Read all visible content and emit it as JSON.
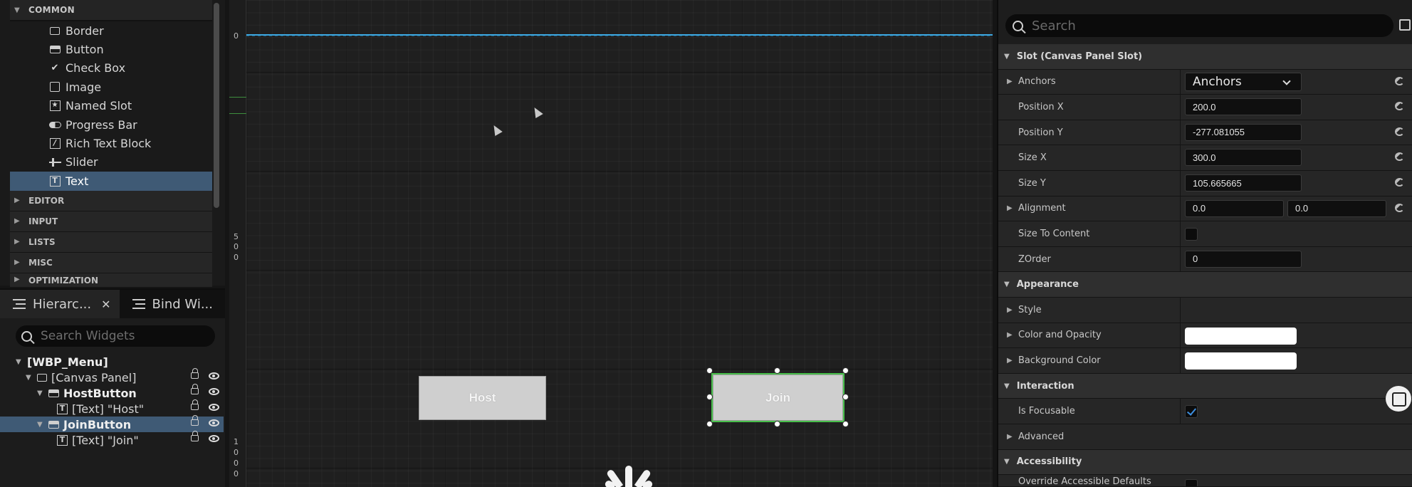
{
  "palette": {
    "common_label": "COMMON",
    "items": [
      {
        "label": "Border",
        "icon": "border-icon"
      },
      {
        "label": "Button",
        "icon": "button-icon"
      },
      {
        "label": "Check Box",
        "icon": "checkbox-icon"
      },
      {
        "label": "Image",
        "icon": "image-icon"
      },
      {
        "label": "Named Slot",
        "icon": "named-slot-icon"
      },
      {
        "label": "Progress Bar",
        "icon": "progress-bar-icon"
      },
      {
        "label": "Rich Text Block",
        "icon": "rich-text-icon"
      },
      {
        "label": "Slider",
        "icon": "slider-icon"
      },
      {
        "label": "Text",
        "icon": "text-icon"
      }
    ],
    "categories": [
      "EDITOR",
      "INPUT",
      "LISTS",
      "MISC",
      "OPTIMIZATION"
    ]
  },
  "hierarchy": {
    "tab_hierarchy": "Hierarc...",
    "tab_bind": "Bind Wi...",
    "search_placeholder": "Search Widgets",
    "root": "[WBP_Menu]",
    "canvas": "[Canvas Panel]",
    "host_button": "HostButton",
    "host_text": "[Text] \"Host\"",
    "join_button": "JoinButton",
    "join_text": "[Text] \"Join\""
  },
  "ruler": {
    "top": "0",
    "mid": [
      "5",
      "0",
      "0"
    ],
    "bottom": [
      "1",
      "0",
      "0",
      "0"
    ]
  },
  "canvas": {
    "host_label": "Host",
    "join_label": "Join"
  },
  "details": {
    "search_placeholder": "Search",
    "slot_section": "Slot (Canvas Panel Slot)",
    "anchors_label": "Anchors",
    "anchors_value": "Anchors",
    "position_x_label": "Position X",
    "position_x_value": "200.0",
    "position_y_label": "Position Y",
    "position_y_value": "-277.081055",
    "size_x_label": "Size X",
    "size_x_value": "300.0",
    "size_y_label": "Size Y",
    "size_y_value": "105.665665",
    "alignment_label": "Alignment",
    "alignment_x": "0.0",
    "alignment_y": "0.0",
    "size_to_content_label": "Size To Content",
    "zorder_label": "ZOrder",
    "zorder_value": "0",
    "appearance_section": "Appearance",
    "style_label": "Style",
    "color_opacity_label": "Color and Opacity",
    "background_color_label": "Background Color",
    "interaction_section": "Interaction",
    "is_focusable_label": "Is Focusable",
    "advanced_label": "Advanced",
    "accessibility_section": "Accessibility",
    "override_label": "Override Accessible Defaults"
  },
  "colors": {
    "selection": "#3f5a75",
    "guide": "#3da7e0",
    "selected_outline": "#49c04c",
    "widget_button": "#cfcfcf"
  }
}
